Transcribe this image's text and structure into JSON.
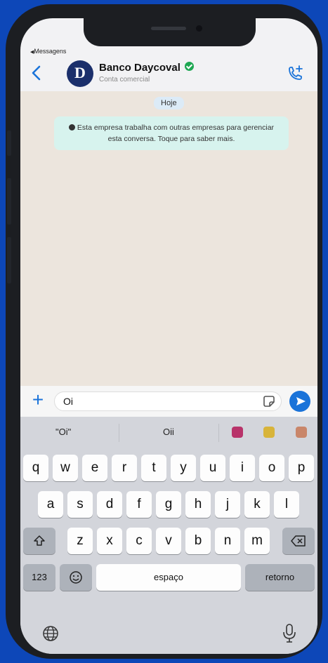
{
  "status_bar": {
    "back_app": "Messagens"
  },
  "header": {
    "avatar_letter": "D",
    "title": "Banco Daycoval",
    "subtitle": "Conta comercial"
  },
  "chat": {
    "date": "Hoje",
    "notice": "Esta empresa trabalha com outras empresas para gerenciar esta conversa. Toque para saber mais."
  },
  "composer": {
    "value": "Oi"
  },
  "suggestions": [
    "\"Oi\"",
    "Oii"
  ],
  "keyboard": {
    "row1": [
      "q",
      "w",
      "e",
      "r",
      "t",
      "y",
      "u",
      "i",
      "o",
      "p"
    ],
    "row2": [
      "a",
      "s",
      "d",
      "f",
      "g",
      "h",
      "j",
      "k",
      "l"
    ],
    "row3": [
      "z",
      "x",
      "c",
      "v",
      "b",
      "n",
      "m"
    ],
    "numbers_label": "123",
    "space_label": "espaço",
    "return_label": "retorno"
  },
  "colors": {
    "accent": "#1a73d9",
    "background": "#0d47b8",
    "verified": "#1ea752"
  }
}
